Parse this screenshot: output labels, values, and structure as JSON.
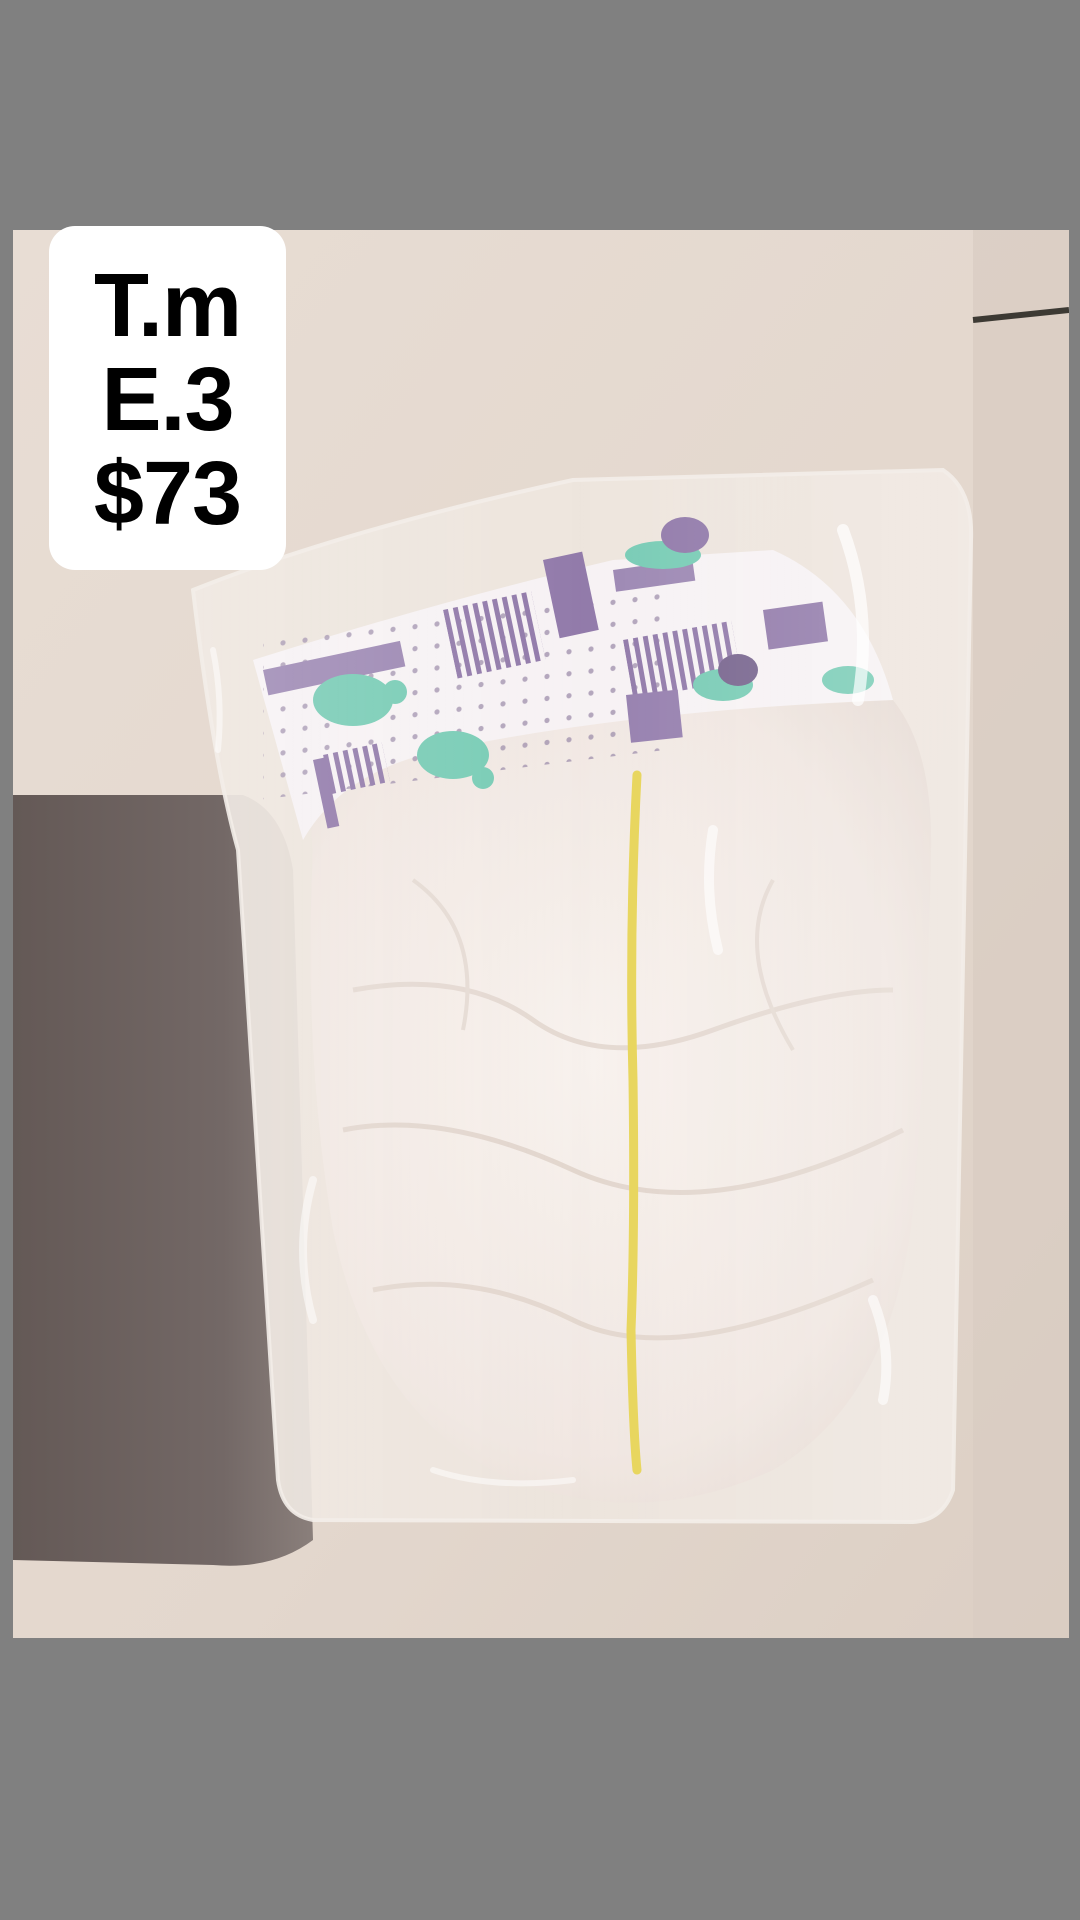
{
  "overlay": {
    "lines": [
      "T.m",
      "E.3",
      "$73"
    ]
  },
  "colors": {
    "page_background": "#808080",
    "card_background": "#ffffff",
    "card_text": "#000000",
    "sheet": "#e7ddd4",
    "shadow_area": "#6f6462",
    "diaper_body": "#f3ebe6",
    "waistband_purple": "#8b73a6",
    "print_green": "#6fc8b0",
    "wetness_strip": "#e6d24e"
  },
  "image": {
    "subject": "diaper-in-plastic-bag"
  }
}
